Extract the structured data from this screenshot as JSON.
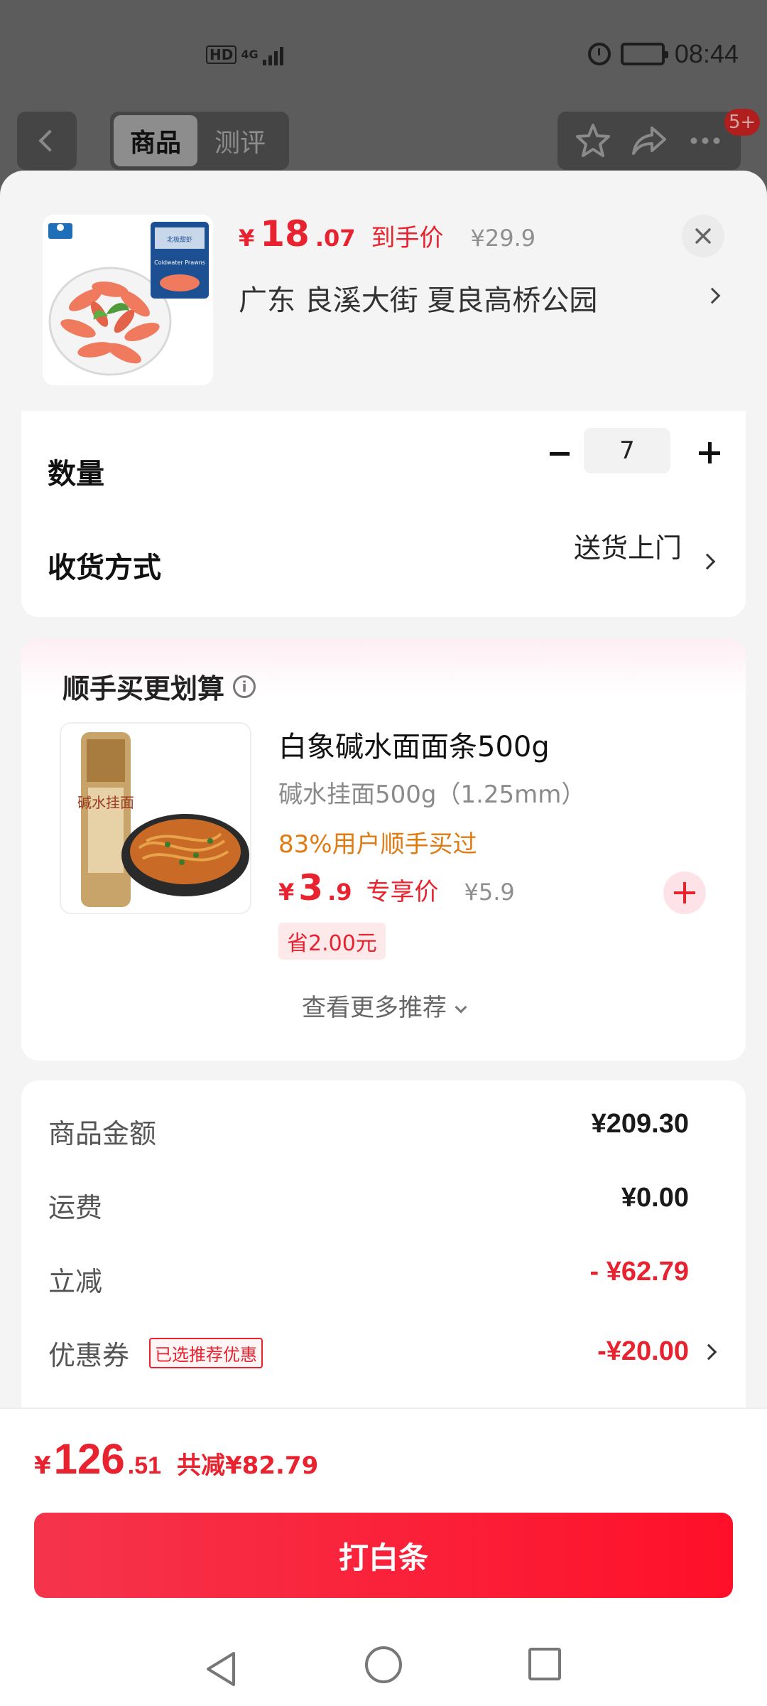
{
  "status_bar": {
    "hd": "HD",
    "network": "4G",
    "time": "08:44"
  },
  "nav": {
    "tabs": [
      {
        "label": "商品",
        "active": true
      },
      {
        "label": "测评",
        "active": false
      }
    ],
    "badge": "5+"
  },
  "product": {
    "price_currency": "¥",
    "price_integer": "18",
    "price_decimal": ".07",
    "price_tag": "到手价",
    "original_price": "¥29.9",
    "address": "广东  良溪大街 夏良高桥公园",
    "package_text_1": "北极甜虾",
    "package_text_2": "Coldwater Prawns"
  },
  "order_options": {
    "quantity_label": "数量",
    "quantity_value": "7",
    "delivery_label": "收货方式",
    "delivery_value": "送货上门"
  },
  "recommend": {
    "title": "顺手买更划算",
    "item": {
      "name": "白象碱水面面条500g",
      "spec": "碱水挂面500g（1.25mm）",
      "social_proof": "83%用户顺手买过",
      "price_currency": "¥",
      "price_integer": "3",
      "price_decimal": ".9",
      "price_tag": "专享价",
      "original_price": "¥5.9",
      "save_badge": "省2.00元",
      "package_text": "碱水挂面"
    },
    "more_label": "查看更多推荐"
  },
  "summary": {
    "rows": [
      {
        "label": "商品金额",
        "value": "¥209.30"
      },
      {
        "label": "运费",
        "value": "¥0.00"
      },
      {
        "label": "立减",
        "value": "- ¥62.79"
      },
      {
        "label": "优惠券",
        "value": "-¥20.00",
        "tag": "已选推荐优惠"
      }
    ]
  },
  "footer": {
    "total_currency": "¥",
    "total_integer": "126",
    "total_decimal": ".51",
    "total_reduce": "共减¥82.79",
    "pay_button": "打白条"
  },
  "colors": {
    "accent_red": "#e8232f",
    "social_orange": "#e07a12",
    "sheet_bg": "#f4f4f4"
  }
}
